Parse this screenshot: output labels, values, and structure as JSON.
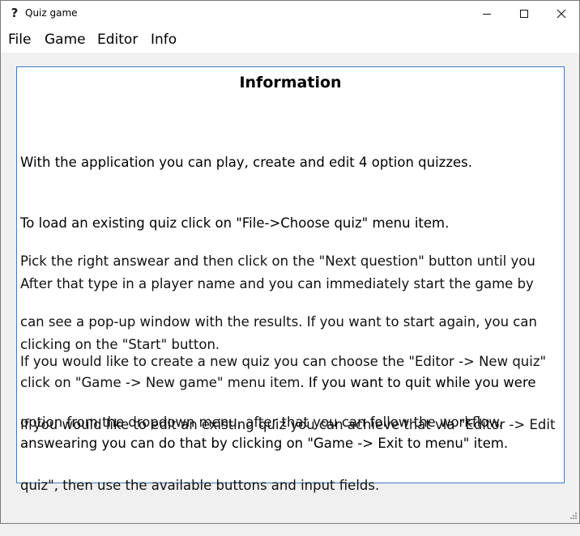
{
  "window": {
    "title": "Quiz game",
    "app_icon": "question-mark-icon",
    "controls": [
      "minimize-icon",
      "maximize-icon",
      "close-icon"
    ]
  },
  "menubar": {
    "items": [
      {
        "label": "File"
      },
      {
        "label": "Game"
      },
      {
        "label": "Editor"
      },
      {
        "label": "Info"
      }
    ]
  },
  "content": {
    "heading": "Information",
    "paragraph1": {
      "line1": "With the application you can play, create and edit 4 option quizzes.",
      "line2": "To load an existing quiz click on \"File->Choose quiz\" menu item.",
      "line3": "After that type in a player name and you can immediately start the game by",
      "line4": "clicking on the \"Start\" button."
    },
    "paragraph2": {
      "line1": "Pick the right answear and then click on the \"Next question\" button until you",
      "line2": "can see a pop-up window with the results. If you want to start again, you can",
      "line3a": "click on \"Game -> New game\" menu item",
      "line3b": ". If you want to quit while you were",
      "line4": "answearing you can do that by clicking on \"Game -> Exit to menu\" item."
    },
    "paragraph3": {
      "line1": "If you would like to create a new quiz you can choose the \"Editor -> New quiz\"",
      "line2": "option from the dropdown menu, after that you can follow the workflow."
    },
    "paragraph4": {
      "line1": "If you would like to edit an existing quiz you can achieve that via \"Editor -> Edit",
      "line2": "quiz\", then use the available buttons and input fields."
    }
  }
}
